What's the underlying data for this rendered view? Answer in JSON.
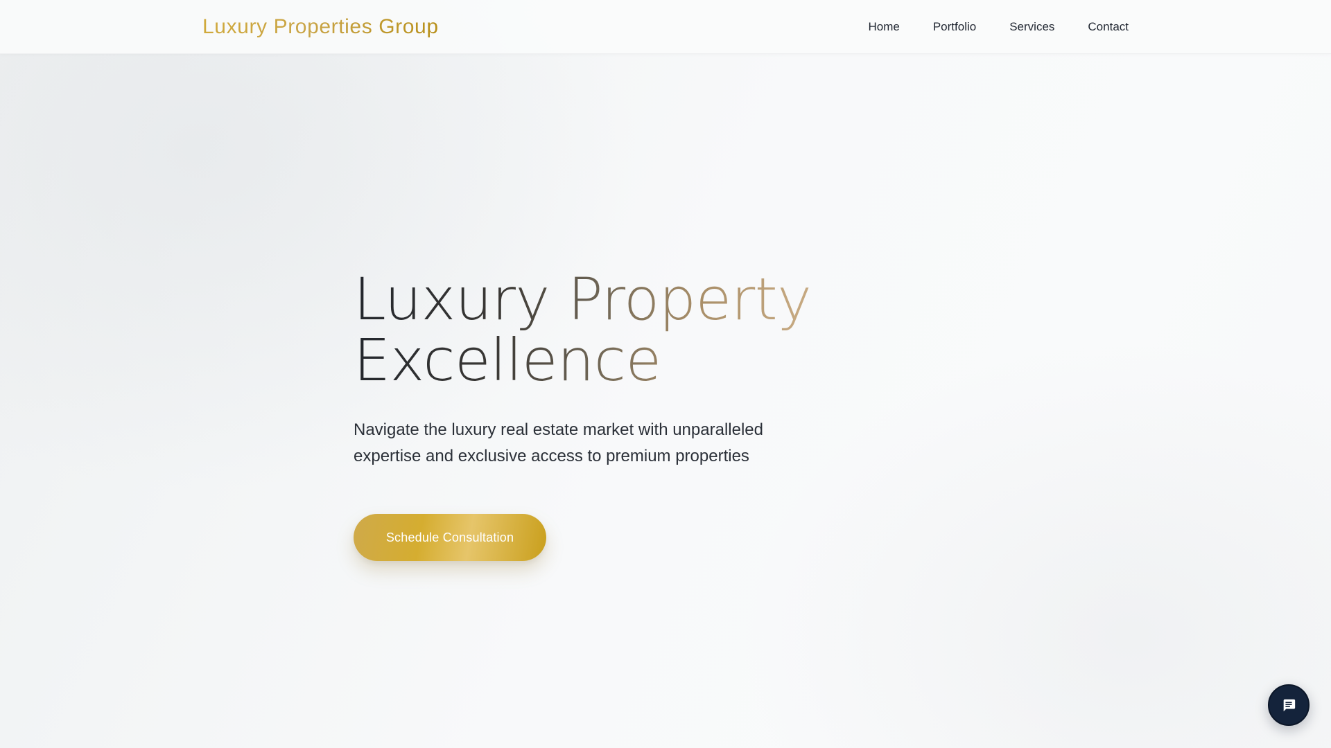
{
  "header": {
    "brand": "Luxury Properties Group",
    "nav": [
      {
        "label": "Home"
      },
      {
        "label": "Portfolio"
      },
      {
        "label": "Services"
      },
      {
        "label": "Contact"
      }
    ]
  },
  "hero": {
    "title_line1": "Luxury Property",
    "title_line2": "Excellence",
    "subtitle": "Navigate the luxury real estate market with unparalleled expertise and exclusive access to premium properties",
    "cta_label": "Schedule Consultation"
  },
  "chat": {
    "icon": "chat-message-icon"
  },
  "colors": {
    "accent_gold": "#d4aa3a",
    "chat_navy": "#14233b",
    "text_dark": "#1f2530"
  }
}
